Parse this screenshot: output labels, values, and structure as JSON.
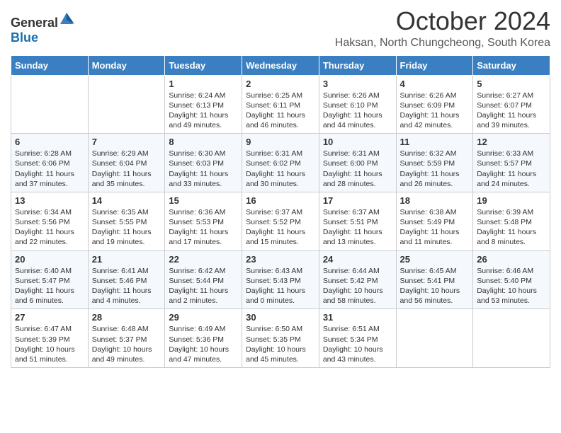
{
  "logo": {
    "general": "General",
    "blue": "Blue"
  },
  "header": {
    "month": "October 2024",
    "location": "Haksan, North Chungcheong, South Korea"
  },
  "weekdays": [
    "Sunday",
    "Monday",
    "Tuesday",
    "Wednesday",
    "Thursday",
    "Friday",
    "Saturday"
  ],
  "weeks": [
    [
      {
        "day": "",
        "sunrise": "",
        "sunset": "",
        "daylight": ""
      },
      {
        "day": "",
        "sunrise": "",
        "sunset": "",
        "daylight": ""
      },
      {
        "day": "1",
        "sunrise": "Sunrise: 6:24 AM",
        "sunset": "Sunset: 6:13 PM",
        "daylight": "Daylight: 11 hours and 49 minutes."
      },
      {
        "day": "2",
        "sunrise": "Sunrise: 6:25 AM",
        "sunset": "Sunset: 6:11 PM",
        "daylight": "Daylight: 11 hours and 46 minutes."
      },
      {
        "day": "3",
        "sunrise": "Sunrise: 6:26 AM",
        "sunset": "Sunset: 6:10 PM",
        "daylight": "Daylight: 11 hours and 44 minutes."
      },
      {
        "day": "4",
        "sunrise": "Sunrise: 6:26 AM",
        "sunset": "Sunset: 6:09 PM",
        "daylight": "Daylight: 11 hours and 42 minutes."
      },
      {
        "day": "5",
        "sunrise": "Sunrise: 6:27 AM",
        "sunset": "Sunset: 6:07 PM",
        "daylight": "Daylight: 11 hours and 39 minutes."
      }
    ],
    [
      {
        "day": "6",
        "sunrise": "Sunrise: 6:28 AM",
        "sunset": "Sunset: 6:06 PM",
        "daylight": "Daylight: 11 hours and 37 minutes."
      },
      {
        "day": "7",
        "sunrise": "Sunrise: 6:29 AM",
        "sunset": "Sunset: 6:04 PM",
        "daylight": "Daylight: 11 hours and 35 minutes."
      },
      {
        "day": "8",
        "sunrise": "Sunrise: 6:30 AM",
        "sunset": "Sunset: 6:03 PM",
        "daylight": "Daylight: 11 hours and 33 minutes."
      },
      {
        "day": "9",
        "sunrise": "Sunrise: 6:31 AM",
        "sunset": "Sunset: 6:02 PM",
        "daylight": "Daylight: 11 hours and 30 minutes."
      },
      {
        "day": "10",
        "sunrise": "Sunrise: 6:31 AM",
        "sunset": "Sunset: 6:00 PM",
        "daylight": "Daylight: 11 hours and 28 minutes."
      },
      {
        "day": "11",
        "sunrise": "Sunrise: 6:32 AM",
        "sunset": "Sunset: 5:59 PM",
        "daylight": "Daylight: 11 hours and 26 minutes."
      },
      {
        "day": "12",
        "sunrise": "Sunrise: 6:33 AM",
        "sunset": "Sunset: 5:57 PM",
        "daylight": "Daylight: 11 hours and 24 minutes."
      }
    ],
    [
      {
        "day": "13",
        "sunrise": "Sunrise: 6:34 AM",
        "sunset": "Sunset: 5:56 PM",
        "daylight": "Daylight: 11 hours and 22 minutes."
      },
      {
        "day": "14",
        "sunrise": "Sunrise: 6:35 AM",
        "sunset": "Sunset: 5:55 PM",
        "daylight": "Daylight: 11 hours and 19 minutes."
      },
      {
        "day": "15",
        "sunrise": "Sunrise: 6:36 AM",
        "sunset": "Sunset: 5:53 PM",
        "daylight": "Daylight: 11 hours and 17 minutes."
      },
      {
        "day": "16",
        "sunrise": "Sunrise: 6:37 AM",
        "sunset": "Sunset: 5:52 PM",
        "daylight": "Daylight: 11 hours and 15 minutes."
      },
      {
        "day": "17",
        "sunrise": "Sunrise: 6:37 AM",
        "sunset": "Sunset: 5:51 PM",
        "daylight": "Daylight: 11 hours and 13 minutes."
      },
      {
        "day": "18",
        "sunrise": "Sunrise: 6:38 AM",
        "sunset": "Sunset: 5:49 PM",
        "daylight": "Daylight: 11 hours and 11 minutes."
      },
      {
        "day": "19",
        "sunrise": "Sunrise: 6:39 AM",
        "sunset": "Sunset: 5:48 PM",
        "daylight": "Daylight: 11 hours and 8 minutes."
      }
    ],
    [
      {
        "day": "20",
        "sunrise": "Sunrise: 6:40 AM",
        "sunset": "Sunset: 5:47 PM",
        "daylight": "Daylight: 11 hours and 6 minutes."
      },
      {
        "day": "21",
        "sunrise": "Sunrise: 6:41 AM",
        "sunset": "Sunset: 5:46 PM",
        "daylight": "Daylight: 11 hours and 4 minutes."
      },
      {
        "day": "22",
        "sunrise": "Sunrise: 6:42 AM",
        "sunset": "Sunset: 5:44 PM",
        "daylight": "Daylight: 11 hours and 2 minutes."
      },
      {
        "day": "23",
        "sunrise": "Sunrise: 6:43 AM",
        "sunset": "Sunset: 5:43 PM",
        "daylight": "Daylight: 11 hours and 0 minutes."
      },
      {
        "day": "24",
        "sunrise": "Sunrise: 6:44 AM",
        "sunset": "Sunset: 5:42 PM",
        "daylight": "Daylight: 10 hours and 58 minutes."
      },
      {
        "day": "25",
        "sunrise": "Sunrise: 6:45 AM",
        "sunset": "Sunset: 5:41 PM",
        "daylight": "Daylight: 10 hours and 56 minutes."
      },
      {
        "day": "26",
        "sunrise": "Sunrise: 6:46 AM",
        "sunset": "Sunset: 5:40 PM",
        "daylight": "Daylight: 10 hours and 53 minutes."
      }
    ],
    [
      {
        "day": "27",
        "sunrise": "Sunrise: 6:47 AM",
        "sunset": "Sunset: 5:39 PM",
        "daylight": "Daylight: 10 hours and 51 minutes."
      },
      {
        "day": "28",
        "sunrise": "Sunrise: 6:48 AM",
        "sunset": "Sunset: 5:37 PM",
        "daylight": "Daylight: 10 hours and 49 minutes."
      },
      {
        "day": "29",
        "sunrise": "Sunrise: 6:49 AM",
        "sunset": "Sunset: 5:36 PM",
        "daylight": "Daylight: 10 hours and 47 minutes."
      },
      {
        "day": "30",
        "sunrise": "Sunrise: 6:50 AM",
        "sunset": "Sunset: 5:35 PM",
        "daylight": "Daylight: 10 hours and 45 minutes."
      },
      {
        "day": "31",
        "sunrise": "Sunrise: 6:51 AM",
        "sunset": "Sunset: 5:34 PM",
        "daylight": "Daylight: 10 hours and 43 minutes."
      },
      {
        "day": "",
        "sunrise": "",
        "sunset": "",
        "daylight": ""
      },
      {
        "day": "",
        "sunrise": "",
        "sunset": "",
        "daylight": ""
      }
    ]
  ]
}
